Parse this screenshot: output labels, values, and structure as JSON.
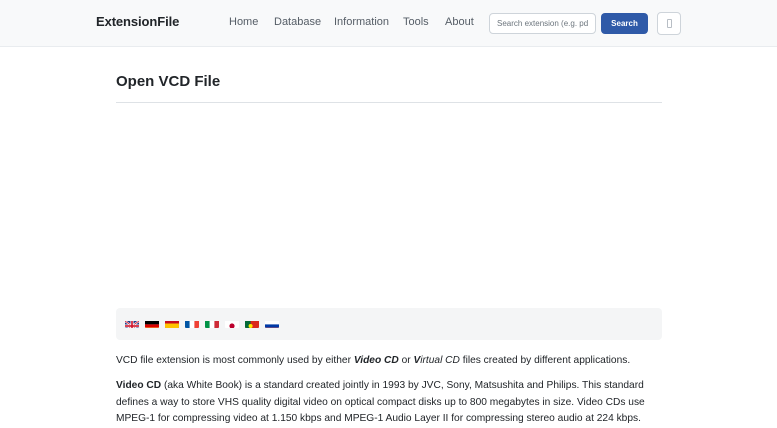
{
  "header": {
    "brand": "ExtensionFile",
    "nav": [
      "Home",
      "Database",
      "Information",
      "Tools",
      "About"
    ],
    "search_placeholder": "Search extension (e.g. pdf)",
    "search_button": "Search"
  },
  "main": {
    "title": "Open VCD File",
    "languages": [
      "English",
      "German",
      "Spanish",
      "French",
      "Italian",
      "Japanese",
      "Portuguese",
      "Russian"
    ],
    "intro": {
      "text1": "VCD file extension is most commonly used by either ",
      "v1": "V",
      "t1": "ideo CD",
      "text2": " or ",
      "v2": "V",
      "t2": "irtual CD",
      "text3": " files created by different applications."
    },
    "details": {
      "term": "Video CD",
      "body": " (aka White Book) is a standard created jointly in 1993 by JVC, Sony, Matsushita and Philips. This standard defines a way to store VHS quality digital video on optical compact disks up to 800 megabytes in size. Video CDs use MPEG-1 for compressing video at 1.150 kbps and MPEG-1 Audio Layer II for compressing stereo audio at 224 kbps."
    }
  }
}
